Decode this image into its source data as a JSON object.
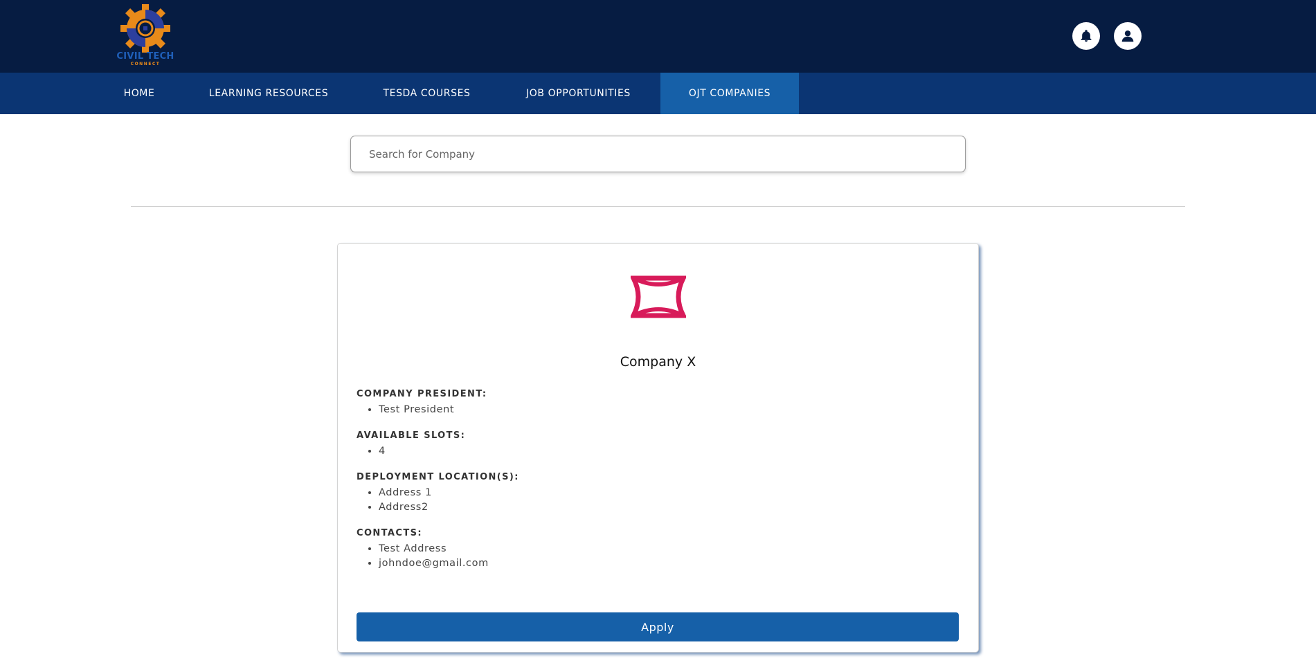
{
  "brand": {
    "name": "CIVIL TECH",
    "sub": "CONNECT"
  },
  "header_icons": {
    "notifications": "bell-icon",
    "profile": "user-icon"
  },
  "nav": {
    "items": [
      {
        "label": "HOME"
      },
      {
        "label": "LEARNING RESOURCES"
      },
      {
        "label": "TESDA COURSES"
      },
      {
        "label": "JOB OPPORTUNITIES"
      },
      {
        "label": "OJT COMPANIES",
        "active": true
      }
    ]
  },
  "search": {
    "placeholder": "Search for Company",
    "value": ""
  },
  "company": {
    "name": "Company X",
    "logo_color": "#d81b5a",
    "president_label": "COMPANY PRESIDENT:",
    "president": [
      "Test President"
    ],
    "slots_label": "AVAILABLE SLOTS:",
    "slots": [
      "4"
    ],
    "locations_label": "DEPLOYMENT LOCATION(S):",
    "locations": [
      "Address 1",
      "Address2"
    ],
    "contacts_label": "CONTACTS:",
    "contacts": [
      "Test Address",
      "johndoe@gmail.com"
    ],
    "apply_label": "Apply"
  },
  "colors": {
    "topbar": "#061c42",
    "navbar": "#0b3573",
    "accent": "#1660a8"
  }
}
